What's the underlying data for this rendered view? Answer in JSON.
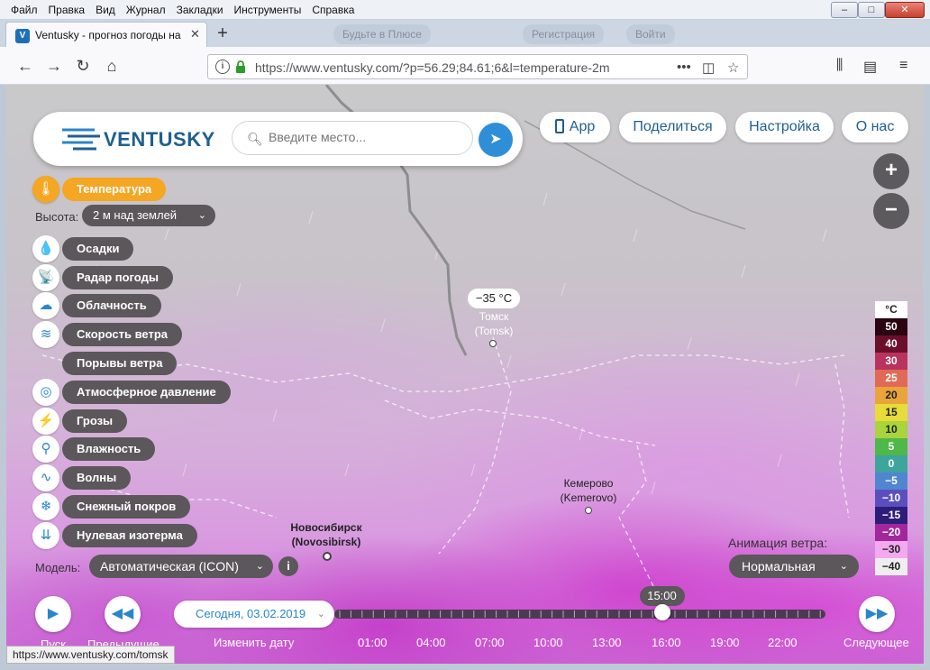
{
  "menubar": {
    "items": [
      "Файл",
      "Правка",
      "Вид",
      "Журнал",
      "Закладки",
      "Инструменты",
      "Справка"
    ]
  },
  "window_controls": {
    "minimize": "–",
    "maximize": "□",
    "close": "✕"
  },
  "tab": {
    "title": "Ventusky - прогноз погоды на",
    "favicon": "V",
    "close": "✕",
    "new": "+"
  },
  "background_tabs": [
    "Будьте в Плюсе",
    "Регистрация",
    "Войти"
  ],
  "navbar": {
    "back": "←",
    "forward": "→",
    "reload": "↻",
    "home": "⌂",
    "url": "https://www.ventusky.com/?p=56.29;84.61;6&l=temperature-2m",
    "page_actions": "•••",
    "pocket": "◫",
    "bookmark": "☆",
    "library": "⫼",
    "sidebar": "▤",
    "menu": "≡"
  },
  "header": {
    "logo": "VENTUSKY",
    "search_placeholder": "Введите место...",
    "locate_icon": "➤",
    "pills": [
      "App",
      "Поделиться",
      "Настройка",
      "О нас"
    ]
  },
  "zoom": {
    "in": "+",
    "out": "−"
  },
  "layers": {
    "active": "Температура",
    "height_label": "Высота:",
    "height_value": "2 м над землей",
    "items": [
      {
        "label": "Осадки",
        "icon": "drop-icon",
        "glyph": "💧"
      },
      {
        "label": "Радар погоды",
        "icon": "radar-icon",
        "glyph": "📡"
      },
      {
        "label": "Облачность",
        "icon": "cloud-icon",
        "glyph": "☁"
      },
      {
        "label": "Скорость ветра",
        "icon": "wind-icon",
        "glyph": "≋"
      },
      {
        "label": "Порывы ветра",
        "icon": "",
        "glyph": ""
      },
      {
        "label": "Атмосферное давление",
        "icon": "pressure-icon",
        "glyph": "◎"
      },
      {
        "label": "Грозы",
        "icon": "lightning-icon",
        "glyph": "⚡"
      },
      {
        "label": "Влажность",
        "icon": "humidity-icon",
        "glyph": "⚲"
      },
      {
        "label": "Волны",
        "icon": "wave-icon",
        "glyph": "∿"
      },
      {
        "label": "Снежный покров",
        "icon": "snowflake-icon",
        "glyph": "❄"
      },
      {
        "label": "Нулевая изотерма",
        "icon": "isotherm-icon",
        "glyph": "⇊"
      }
    ]
  },
  "model": {
    "label": "Модель:",
    "value": "Автоматическая (ICON)",
    "info": "i"
  },
  "cities": {
    "tomsk": {
      "temp": "−35 °C",
      "name": "Томск",
      "latin": "(Tomsk)"
    },
    "kemerovo": {
      "name": "Кемерово",
      "latin": "(Kemerovo)"
    },
    "novosibirsk": {
      "name": "Новосибирск",
      "latin": "(Novosibirsk)"
    }
  },
  "legend": {
    "unit": "°C",
    "stops": [
      {
        "v": "50",
        "bg": "#2a0410",
        "fg": "#fff"
      },
      {
        "v": "40",
        "bg": "#6b0f2a",
        "fg": "#fff"
      },
      {
        "v": "30",
        "bg": "#b8335e",
        "fg": "#fff"
      },
      {
        "v": "25",
        "bg": "#e06a55",
        "fg": "#fff"
      },
      {
        "v": "20",
        "bg": "#e9a43a",
        "fg": "#222"
      },
      {
        "v": "15",
        "bg": "#e7dc3a",
        "fg": "#222"
      },
      {
        "v": "10",
        "bg": "#a9d43b",
        "fg": "#222"
      },
      {
        "v": "5",
        "bg": "#4fb84a",
        "fg": "#fff"
      },
      {
        "v": "0",
        "bg": "#3ea59c",
        "fg": "#fff"
      },
      {
        "v": "−5",
        "bg": "#4f86cf",
        "fg": "#fff"
      },
      {
        "v": "−10",
        "bg": "#5b4fc0",
        "fg": "#fff"
      },
      {
        "v": "−15",
        "bg": "#2d1d7a",
        "fg": "#fff"
      },
      {
        "v": "−20",
        "bg": "#a2279c",
        "fg": "#fff"
      },
      {
        "v": "−30",
        "bg": "#f2a9ef",
        "fg": "#222"
      },
      {
        "v": "−40",
        "bg": "#eeeeee",
        "fg": "#222"
      }
    ]
  },
  "wind": {
    "label": "Анимация ветра:",
    "value": "Нормальная"
  },
  "timeline": {
    "date": "Сегодня, 03.02.2019",
    "change_date": "Изменить дату",
    "current_time": "15:00",
    "current_fraction": 0.667,
    "hours": [
      "01:00",
      "04:00",
      "07:00",
      "10:00",
      "13:00",
      "16:00",
      "19:00",
      "22:00"
    ],
    "play": "Пуск",
    "prev": "Предыдущие",
    "next": "Следующее"
  },
  "statusbar": {
    "url": "https://www.ventusky.com/tomsk"
  }
}
